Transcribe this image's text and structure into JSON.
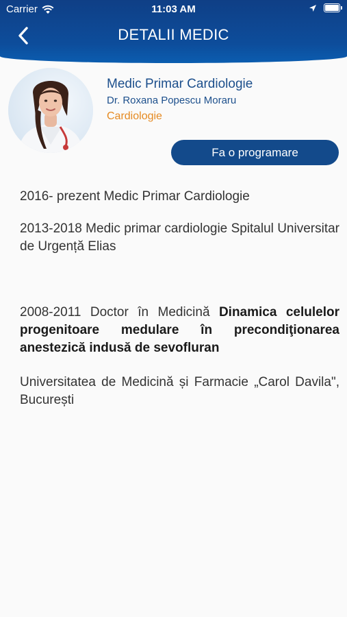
{
  "status_bar": {
    "carrier": "Carrier",
    "time": "11:03 AM"
  },
  "nav": {
    "title": "DETALII MEDIC",
    "back_icon": "chevron-left-icon"
  },
  "doctor": {
    "role_title": "Medic Primar Cardiologie",
    "name": "Dr. Roxana Popescu Moraru",
    "specialty": "Cardiologie",
    "appointment_button": "Fa o programare"
  },
  "cv": {
    "entry1": "2016- prezent Medic Primar Cardiologie",
    "entry2": "2013-2018 Medic primar cardiologie Spitalul Universitar de Urgență Elias",
    "entry3_prefix": "2008-2011 Doctor în Medicină ",
    "entry3_bold": "Dinamica celulelor progenitoare medulare în precondiţionarea anestezică indusă de sevofluran",
    "entry4": "Universitatea de Medicină și Farmacie „Carol Davila\", București"
  },
  "colors": {
    "header": "#0d4d9b",
    "accent_blue": "#1c4f8c",
    "specialty_orange": "#e58a22",
    "button": "#134a8b"
  }
}
